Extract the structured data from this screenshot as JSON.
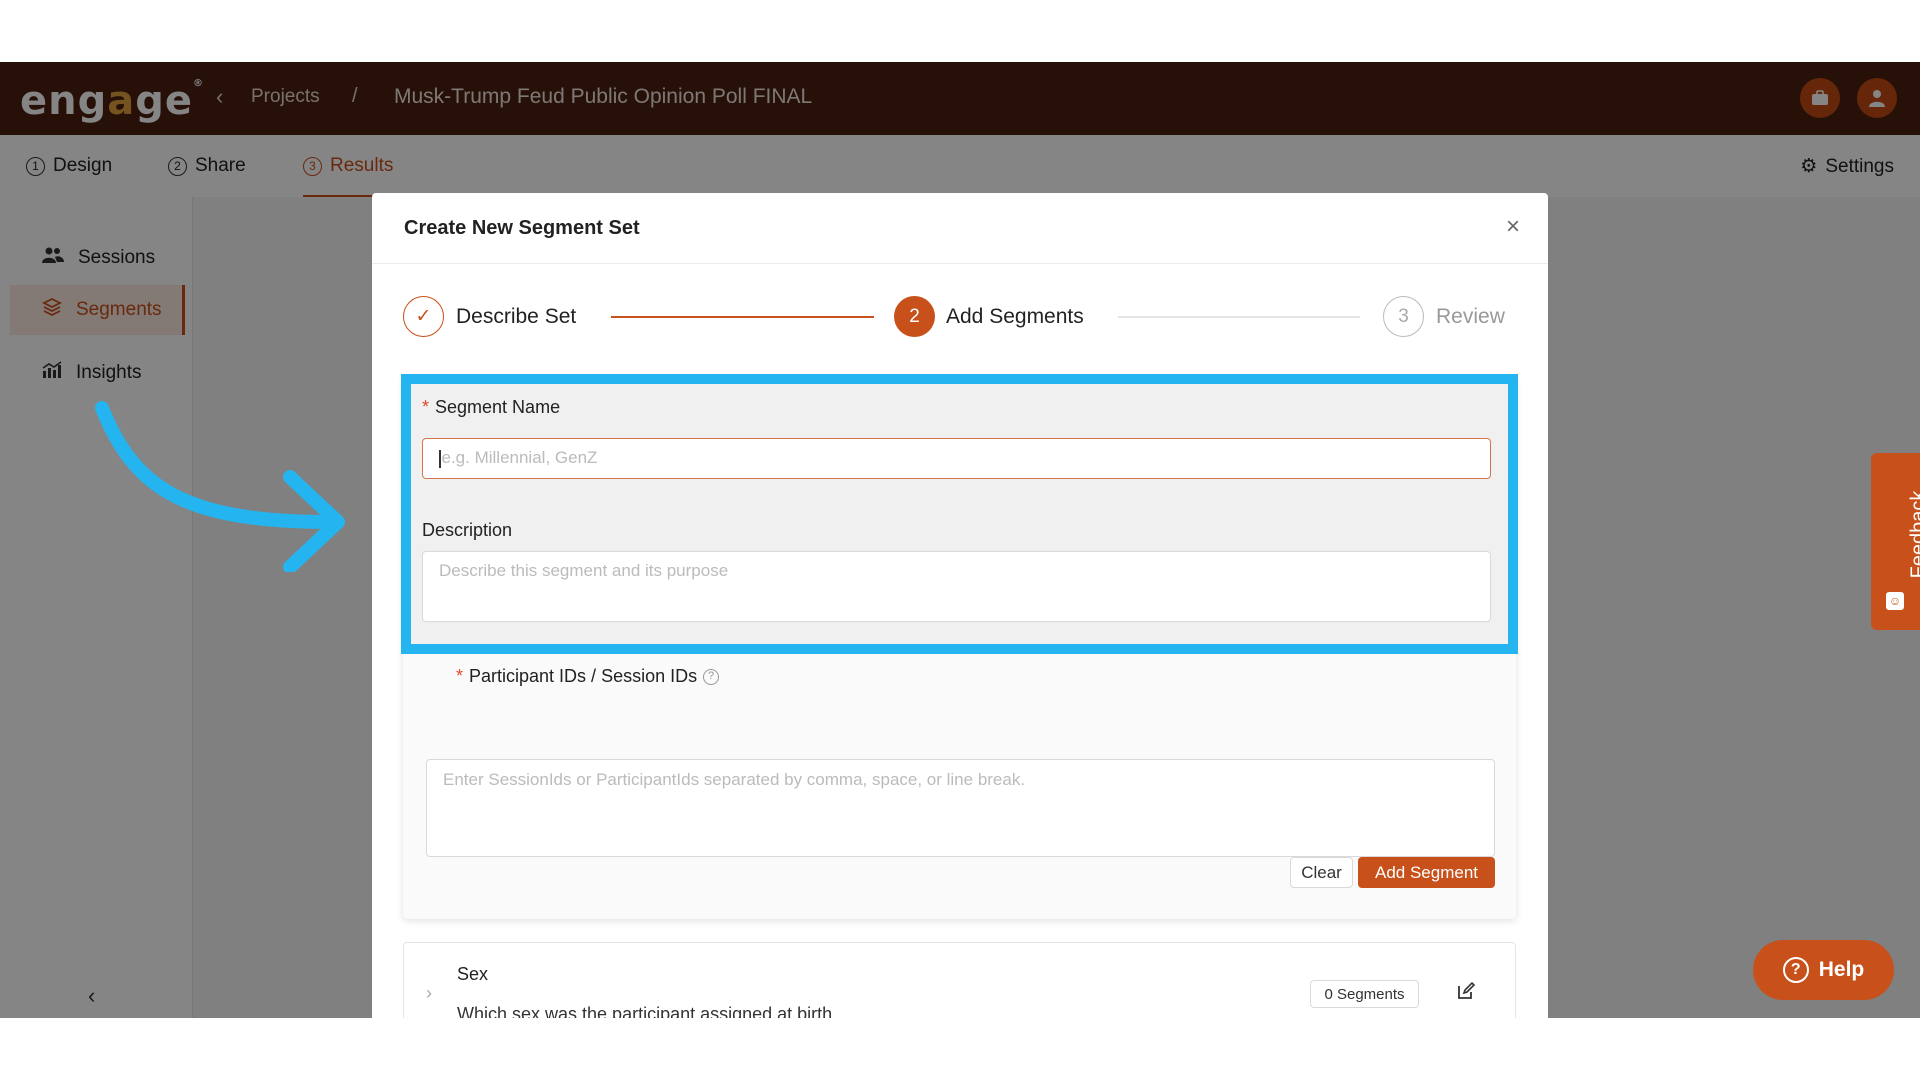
{
  "app": {
    "logo": "engage",
    "breadcrumb": {
      "back_icon": "chevron-left-icon",
      "projects": "Projects",
      "separator": "/",
      "title": "Musk-Trump Feud Public Opinion Poll FINAL"
    }
  },
  "tabs": [
    {
      "num": "1",
      "label": "Design"
    },
    {
      "num": "2",
      "label": "Share"
    },
    {
      "num": "3",
      "label": "Results"
    }
  ],
  "settings_label": "Settings",
  "sidebar": {
    "items": [
      {
        "icon": "users-icon",
        "label": "Sessions"
      },
      {
        "icon": "layers-icon",
        "label": "Segments"
      },
      {
        "icon": "chart-icon",
        "label": "Insights"
      }
    ],
    "collapse_icon": "chevron-left-icon"
  },
  "modal": {
    "title": "Create New Segment Set",
    "close_glyph": "×",
    "steps": [
      {
        "label": "Describe Set",
        "marker": "✓",
        "state": "done"
      },
      {
        "label": "Add Segments",
        "marker": "2",
        "state": "active"
      },
      {
        "label": "Review",
        "marker": "3",
        "state": "pending"
      }
    ],
    "form": {
      "segment_name_label": "Segment Name",
      "segment_name_placeholder": "e.g. Millennial, GenZ",
      "description_label": "Description",
      "description_placeholder": "Describe this segment and its purpose",
      "ids_label": "Participant IDs / Session IDs",
      "ids_placeholder": "Enter SessionIds or ParticipantIds separated by comma, space, or line break.",
      "required_mark": "*",
      "info_glyph": "?",
      "clear_label": "Clear",
      "add_label": "Add Segment"
    },
    "segment_set": {
      "name": "Sex",
      "description": "Which sex was the participant assigned at birth",
      "badge": "0 Segments"
    }
  },
  "feedback_label": "Feedback",
  "help_label": "Help",
  "colors": {
    "brand": "#c8501b",
    "topbar": "#4a1f0e",
    "highlight": "#24b4f0"
  }
}
